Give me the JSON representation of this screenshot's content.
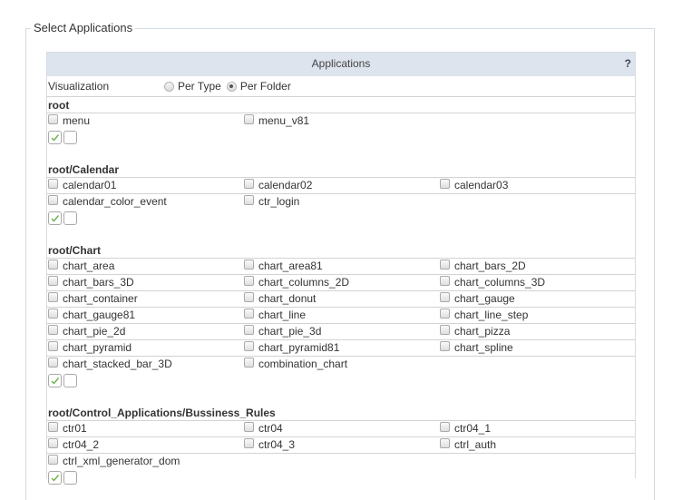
{
  "fieldset": {
    "legend": "Select Applications"
  },
  "panel": {
    "title": "Applications",
    "help": "?",
    "visualization": {
      "label": "Visualization",
      "options": [
        {
          "label": "Per Type",
          "selected": false
        },
        {
          "label": "Per Folder",
          "selected": true
        }
      ]
    },
    "groups": [
      {
        "title": "root",
        "rows": [
          [
            "menu",
            "menu_v81"
          ]
        ]
      },
      {
        "title": "root/Calendar",
        "rows": [
          [
            "calendar01",
            "calendar02",
            "calendar03"
          ],
          [
            "calendar_color_event",
            "ctr_login"
          ]
        ]
      },
      {
        "title": "root/Chart",
        "rows": [
          [
            "chart_area",
            "chart_area81",
            "chart_bars_2D"
          ],
          [
            "chart_bars_3D",
            "chart_columns_2D",
            "chart_columns_3D"
          ],
          [
            "chart_container",
            "chart_donut",
            "chart_gauge"
          ],
          [
            "chart_gauge81",
            "chart_line",
            "chart_line_step"
          ],
          [
            "chart_pie_2d",
            "chart_pie_3d",
            "chart_pizza"
          ],
          [
            "chart_pyramid",
            "chart_pyramid81",
            "chart_spline"
          ],
          [
            "chart_stacked_bar_3D",
            "combination_chart"
          ]
        ]
      },
      {
        "title": "root/Control_Applications/Bussiness_Rules",
        "rows": [
          [
            "ctr01",
            "ctr04",
            "ctr04_1"
          ],
          [
            "ctr04_2",
            "ctr04_3",
            "ctrl_auth"
          ],
          [
            "ctrl_xml_generator_dom"
          ]
        ]
      }
    ],
    "group_actions": {
      "select_all": "check-all-icon",
      "deselect_all": "uncheck-all-icon"
    }
  },
  "colors": {
    "header_bg": "#dde4ed",
    "border": "#d3dbe3",
    "check": "#6ab04c"
  }
}
